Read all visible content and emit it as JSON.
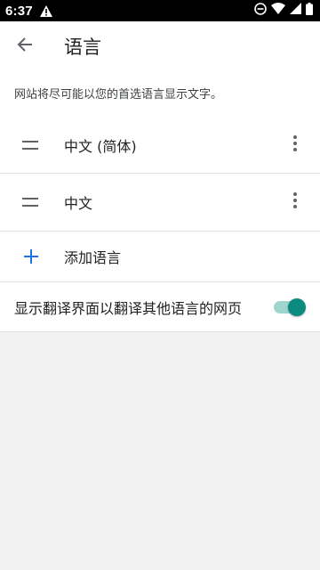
{
  "status_bar": {
    "time": "6:37",
    "icons": [
      "warning-icon",
      "do-not-disturb-icon",
      "wifi-icon",
      "signal-icon",
      "battery-icon"
    ]
  },
  "app_bar": {
    "back_icon": "arrow-back-icon",
    "title": "语言"
  },
  "description": "网站将尽可能以您的首选语言显示文字。",
  "languages": [
    {
      "label": "中文 (简体)",
      "drag_icon": "drag-handle-icon",
      "menu_icon": "more-vert-icon"
    },
    {
      "label": "中文",
      "drag_icon": "drag-handle-icon",
      "menu_icon": "more-vert-icon"
    }
  ],
  "add_language": {
    "icon": "plus-icon",
    "label": "添加语言"
  },
  "translate_setting": {
    "label": "显示翻译界面以翻译其他语言的网页",
    "enabled": true
  },
  "colors": {
    "accent": "#0b8b7e",
    "accent_track": "#9fd4cf",
    "add_icon": "#1a73e8",
    "background": "#f2f2f2"
  }
}
